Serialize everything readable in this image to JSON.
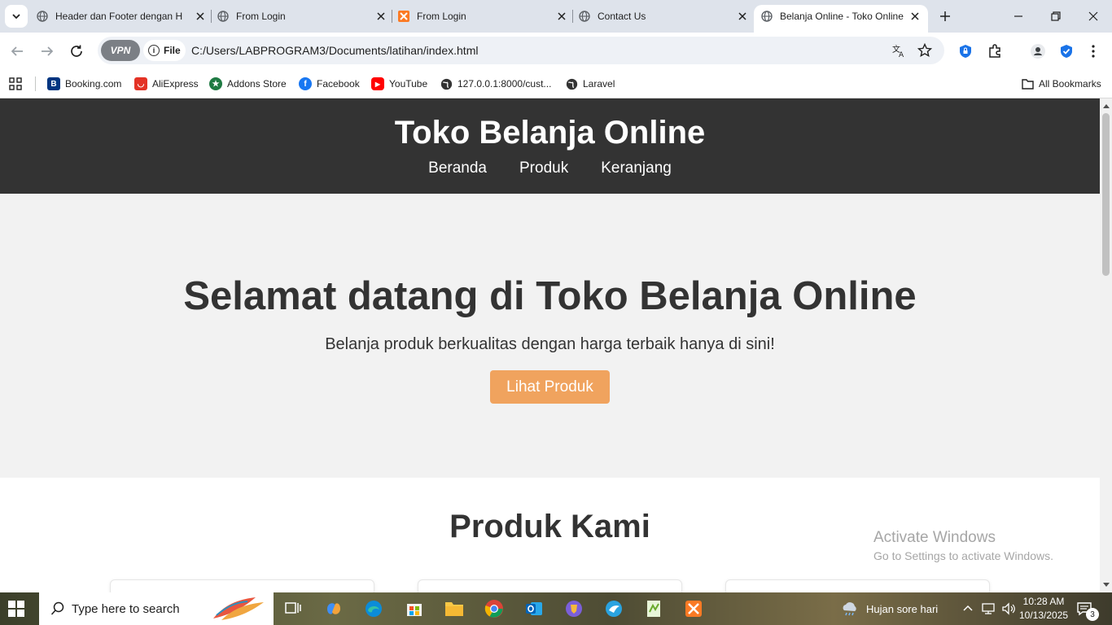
{
  "browser": {
    "tabs": [
      {
        "title": "Header dan Footer dengan H",
        "icon": "globe-icon"
      },
      {
        "title": "From Login",
        "icon": "globe-icon"
      },
      {
        "title": "From Login",
        "icon": "xampp-icon"
      },
      {
        "title": "Contact Us",
        "icon": "globe-icon"
      },
      {
        "title": "Belanja Online - Toko Online",
        "icon": "globe-icon",
        "active": true
      }
    ],
    "vpn_label": "VPN",
    "file_label": "File",
    "url": "C:/Users/LABPROGRAM3/Documents/latihan/index.html"
  },
  "bookmarks": {
    "items": [
      {
        "label": "Booking.com",
        "icon": "booking-icon",
        "color": "#003580",
        "glyph": "B"
      },
      {
        "label": "AliExpress",
        "icon": "aliexpress-icon",
        "color": "#e43225",
        "glyph": "◡"
      },
      {
        "label": "Addons Store",
        "icon": "addons-store-icon",
        "color": "#1f7a43",
        "glyph": "★"
      },
      {
        "label": "Facebook",
        "icon": "facebook-icon",
        "color": "#1877f2",
        "glyph": "f"
      },
      {
        "label": "YouTube",
        "icon": "youtube-icon",
        "color": "#ff0000",
        "glyph": "▶"
      },
      {
        "label": "127.0.0.1:8000/cust...",
        "icon": "globe-icon",
        "color": "#333333",
        "glyph": ""
      },
      {
        "label": "Laravel",
        "icon": "globe-icon",
        "color": "#333333",
        "glyph": ""
      }
    ],
    "all_bookmarks": "All Bookmarks"
  },
  "site": {
    "title": "Toko Belanja Online",
    "nav": [
      "Beranda",
      "Produk",
      "Keranjang"
    ],
    "hero_title": "Selamat datang di Toko Belanja Online",
    "hero_subtitle": "Belanja produk berkualitas dengan harga terbaik hanya di sini!",
    "hero_button": "Lihat Produk",
    "products_title": "Produk Kami",
    "colors": {
      "header_bg": "#333333",
      "hero_bg": "#f2f2f2",
      "button": "#f0a35e"
    }
  },
  "watermark": {
    "line1": "Activate Windows",
    "line2": "Go to Settings to activate Windows."
  },
  "taskbar": {
    "search_placeholder": "Type here to search",
    "weather": "Hujan sore hari",
    "time": "10:28 AM",
    "date": "10/13/2025",
    "notification_count": "3"
  }
}
